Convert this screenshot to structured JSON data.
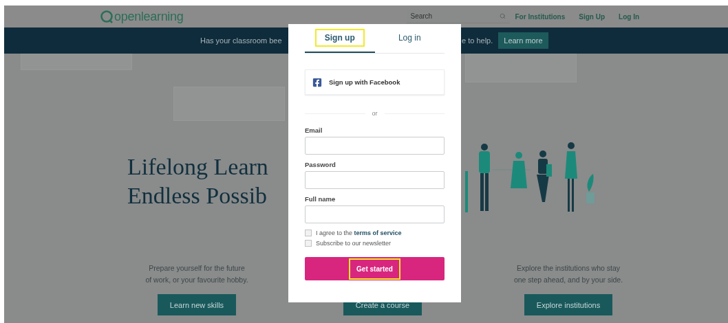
{
  "header": {
    "logo": "openlearning",
    "search": {
      "placeholder": "Search"
    },
    "links": [
      "For Institutions",
      "Sign Up",
      "Log In"
    ]
  },
  "banner": {
    "text_before": "Has your classroom bee",
    "text_after": "e to help.",
    "button": "Learn more"
  },
  "hero": {
    "lines": [
      "Lifelong Learn",
      "Endless Possib"
    ]
  },
  "columns": [
    {
      "lines": [
        "Prepare yourself for the future",
        "of work, or your favourite hobby."
      ],
      "button": "Learn new skills"
    },
    {
      "button": "Create a course"
    },
    {
      "lines": [
        "Explore the institutions who stay",
        "one step ahead, and by your side."
      ],
      "button": "Explore institutions"
    }
  ],
  "modal": {
    "tabs": [
      {
        "label": "Sign up",
        "selected": true,
        "highlighted": true
      },
      {
        "label": "Log in",
        "selected": false,
        "highlighted": false
      }
    ],
    "facebook_button": "Sign up with Facebook",
    "divider": "or",
    "fields": [
      {
        "label": "Email"
      },
      {
        "label": "Password"
      },
      {
        "label": "Full name"
      }
    ],
    "checkboxes": [
      {
        "text": "I agree to the",
        "link": "terms of service",
        "checked": false
      },
      {
        "text": "Subscribe to our newsletter",
        "checked": false
      }
    ],
    "submit": {
      "label": "Get started",
      "highlighted": true
    }
  }
}
